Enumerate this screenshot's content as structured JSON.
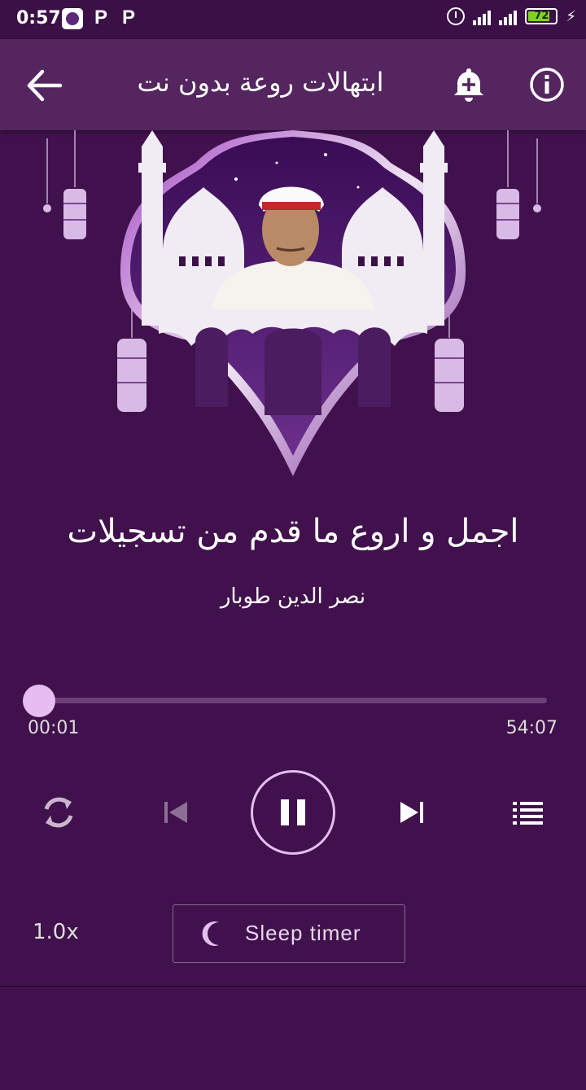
{
  "status_bar": {
    "time": "0:57",
    "notification_letters": [
      "P",
      "P"
    ],
    "battery": "72",
    "icons": [
      "app-icon",
      "alarm-icon",
      "signal-icon",
      "signal-icon",
      "battery-icon",
      "charging-icon"
    ]
  },
  "app_bar": {
    "title": "ابتهالات روعة  بدون نت",
    "icons": [
      "back-arrow-icon",
      "add-alert-bell-icon",
      "info-icon"
    ]
  },
  "track": {
    "title": "اجمل و اروع ما قدم من تسجيلات",
    "artist": "نصر الدين طوبار"
  },
  "player": {
    "current_time": "00:01",
    "total_time": "54:07",
    "progress": 0.0003,
    "controls": [
      "repeat-icon",
      "skip-previous-icon",
      "pause-icon",
      "skip-next-icon",
      "queue-list-icon"
    ]
  },
  "footer": {
    "speed": "1.0x",
    "sleep_timer_label": "Sleep timer",
    "sleep_icon": "moon-icon"
  },
  "colors": {
    "background": "#40114c",
    "app_bar": "#54255f",
    "accent": "#e6bdf0"
  }
}
